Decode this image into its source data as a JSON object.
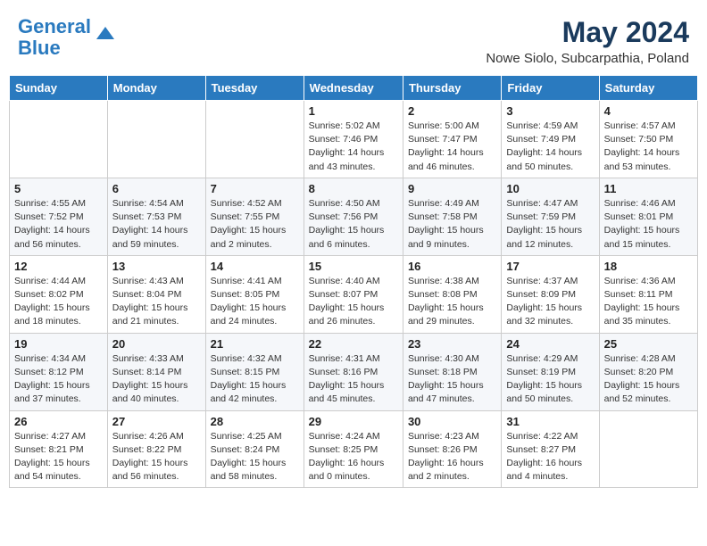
{
  "header": {
    "logo_line1": "General",
    "logo_line2": "Blue",
    "month_title": "May 2024",
    "location": "Nowe Siolo, Subcarpathia, Poland"
  },
  "weekdays": [
    "Sunday",
    "Monday",
    "Tuesday",
    "Wednesday",
    "Thursday",
    "Friday",
    "Saturday"
  ],
  "weeks": [
    [
      {
        "day": "",
        "info": ""
      },
      {
        "day": "",
        "info": ""
      },
      {
        "day": "",
        "info": ""
      },
      {
        "day": "1",
        "info": "Sunrise: 5:02 AM\nSunset: 7:46 PM\nDaylight: 14 hours\nand 43 minutes."
      },
      {
        "day": "2",
        "info": "Sunrise: 5:00 AM\nSunset: 7:47 PM\nDaylight: 14 hours\nand 46 minutes."
      },
      {
        "day": "3",
        "info": "Sunrise: 4:59 AM\nSunset: 7:49 PM\nDaylight: 14 hours\nand 50 minutes."
      },
      {
        "day": "4",
        "info": "Sunrise: 4:57 AM\nSunset: 7:50 PM\nDaylight: 14 hours\nand 53 minutes."
      }
    ],
    [
      {
        "day": "5",
        "info": "Sunrise: 4:55 AM\nSunset: 7:52 PM\nDaylight: 14 hours\nand 56 minutes."
      },
      {
        "day": "6",
        "info": "Sunrise: 4:54 AM\nSunset: 7:53 PM\nDaylight: 14 hours\nand 59 minutes."
      },
      {
        "day": "7",
        "info": "Sunrise: 4:52 AM\nSunset: 7:55 PM\nDaylight: 15 hours\nand 2 minutes."
      },
      {
        "day": "8",
        "info": "Sunrise: 4:50 AM\nSunset: 7:56 PM\nDaylight: 15 hours\nand 6 minutes."
      },
      {
        "day": "9",
        "info": "Sunrise: 4:49 AM\nSunset: 7:58 PM\nDaylight: 15 hours\nand 9 minutes."
      },
      {
        "day": "10",
        "info": "Sunrise: 4:47 AM\nSunset: 7:59 PM\nDaylight: 15 hours\nand 12 minutes."
      },
      {
        "day": "11",
        "info": "Sunrise: 4:46 AM\nSunset: 8:01 PM\nDaylight: 15 hours\nand 15 minutes."
      }
    ],
    [
      {
        "day": "12",
        "info": "Sunrise: 4:44 AM\nSunset: 8:02 PM\nDaylight: 15 hours\nand 18 minutes."
      },
      {
        "day": "13",
        "info": "Sunrise: 4:43 AM\nSunset: 8:04 PM\nDaylight: 15 hours\nand 21 minutes."
      },
      {
        "day": "14",
        "info": "Sunrise: 4:41 AM\nSunset: 8:05 PM\nDaylight: 15 hours\nand 24 minutes."
      },
      {
        "day": "15",
        "info": "Sunrise: 4:40 AM\nSunset: 8:07 PM\nDaylight: 15 hours\nand 26 minutes."
      },
      {
        "day": "16",
        "info": "Sunrise: 4:38 AM\nSunset: 8:08 PM\nDaylight: 15 hours\nand 29 minutes."
      },
      {
        "day": "17",
        "info": "Sunrise: 4:37 AM\nSunset: 8:09 PM\nDaylight: 15 hours\nand 32 minutes."
      },
      {
        "day": "18",
        "info": "Sunrise: 4:36 AM\nSunset: 8:11 PM\nDaylight: 15 hours\nand 35 minutes."
      }
    ],
    [
      {
        "day": "19",
        "info": "Sunrise: 4:34 AM\nSunset: 8:12 PM\nDaylight: 15 hours\nand 37 minutes."
      },
      {
        "day": "20",
        "info": "Sunrise: 4:33 AM\nSunset: 8:14 PM\nDaylight: 15 hours\nand 40 minutes."
      },
      {
        "day": "21",
        "info": "Sunrise: 4:32 AM\nSunset: 8:15 PM\nDaylight: 15 hours\nand 42 minutes."
      },
      {
        "day": "22",
        "info": "Sunrise: 4:31 AM\nSunset: 8:16 PM\nDaylight: 15 hours\nand 45 minutes."
      },
      {
        "day": "23",
        "info": "Sunrise: 4:30 AM\nSunset: 8:18 PM\nDaylight: 15 hours\nand 47 minutes."
      },
      {
        "day": "24",
        "info": "Sunrise: 4:29 AM\nSunset: 8:19 PM\nDaylight: 15 hours\nand 50 minutes."
      },
      {
        "day": "25",
        "info": "Sunrise: 4:28 AM\nSunset: 8:20 PM\nDaylight: 15 hours\nand 52 minutes."
      }
    ],
    [
      {
        "day": "26",
        "info": "Sunrise: 4:27 AM\nSunset: 8:21 PM\nDaylight: 15 hours\nand 54 minutes."
      },
      {
        "day": "27",
        "info": "Sunrise: 4:26 AM\nSunset: 8:22 PM\nDaylight: 15 hours\nand 56 minutes."
      },
      {
        "day": "28",
        "info": "Sunrise: 4:25 AM\nSunset: 8:24 PM\nDaylight: 15 hours\nand 58 minutes."
      },
      {
        "day": "29",
        "info": "Sunrise: 4:24 AM\nSunset: 8:25 PM\nDaylight: 16 hours\nand 0 minutes."
      },
      {
        "day": "30",
        "info": "Sunrise: 4:23 AM\nSunset: 8:26 PM\nDaylight: 16 hours\nand 2 minutes."
      },
      {
        "day": "31",
        "info": "Sunrise: 4:22 AM\nSunset: 8:27 PM\nDaylight: 16 hours\nand 4 minutes."
      },
      {
        "day": "",
        "info": ""
      }
    ]
  ]
}
